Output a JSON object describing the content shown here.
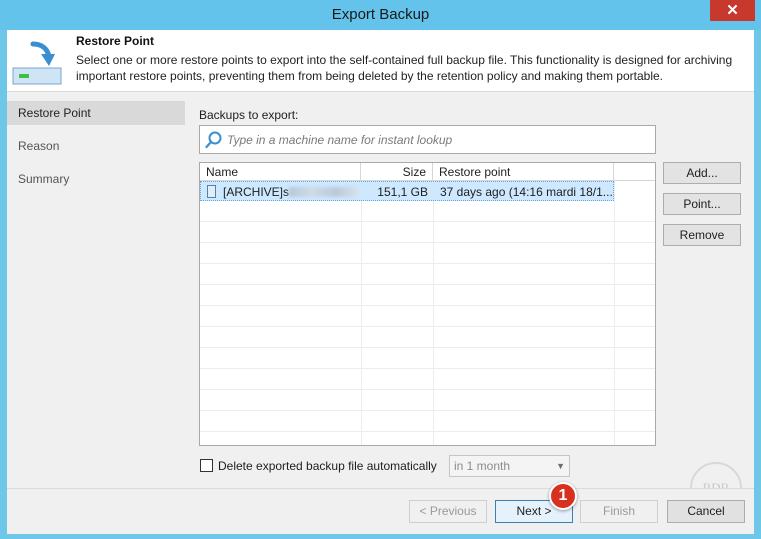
{
  "window": {
    "title": "Export Backup",
    "close_glyph": "✕"
  },
  "header": {
    "title": "Restore Point",
    "description": "Select one or more restore points to export into the self-contained full backup file. This functionality is designed for archiving important restore points, preventing them from being deleted by the retention policy and making them portable.",
    "icon": "restore-point-icon"
  },
  "sidebar": {
    "items": [
      {
        "label": "Restore Point",
        "active": true
      },
      {
        "label": "Reason",
        "active": false
      },
      {
        "label": "Summary",
        "active": false
      }
    ]
  },
  "main": {
    "backups_label": "Backups to export:",
    "search_placeholder": "Type in a machine name for instant lookup",
    "table": {
      "columns": [
        "Name",
        "Size",
        "Restore point"
      ],
      "rows": [
        {
          "name": "[ARCHIVE]s",
          "size": "151,1 GB",
          "restore_point": "37 days ago (14:16 mardi 18/1..."
        }
      ]
    },
    "buttons": {
      "add": "Add...",
      "point": "Point...",
      "remove": "Remove"
    },
    "delete_checkbox_label": "Delete exported backup file automatically",
    "delete_checked": false,
    "retention_select": "in 1 month"
  },
  "footer": {
    "previous": "< Previous",
    "next": "Next >",
    "finish": "Finish",
    "cancel": "Cancel"
  },
  "annotation": {
    "badge_number": "1",
    "watermark": "RDR"
  },
  "colors": {
    "titlebar": "#63c3ea",
    "close": "#c7392c",
    "selection": "#cde8ff",
    "badge": "#d7301f"
  }
}
